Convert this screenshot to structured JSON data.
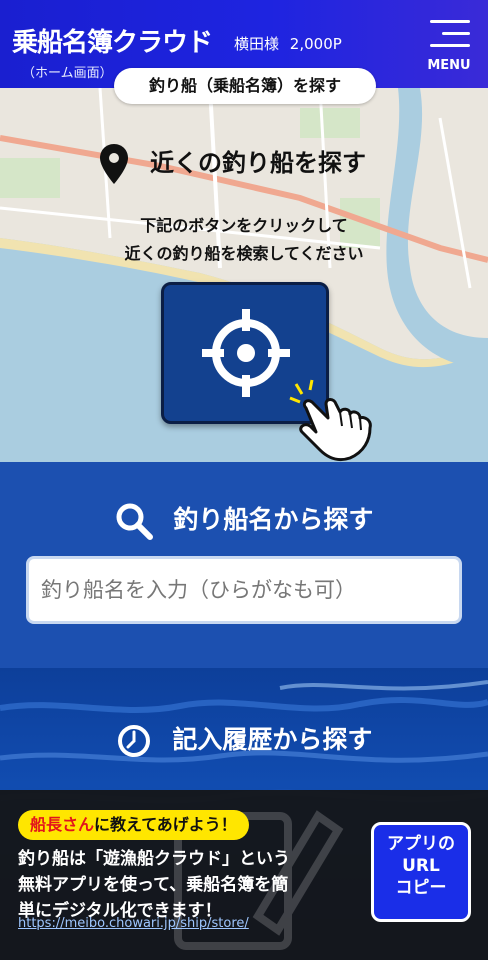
{
  "header": {
    "app_title": "乗船名簿クラウド",
    "subtitle": "（ホーム画面）",
    "user": "横田様",
    "points": "2,000P",
    "menu_label": "MENU"
  },
  "page_pill": "釣り船（乗船名簿）を探す",
  "nearby": {
    "title": "近くの釣り船を探す",
    "desc_line1": "下記のボタンをクリックして",
    "desc_line2": "近くの釣り船を検索してください"
  },
  "search": {
    "title": "釣り船名から探す",
    "placeholder": "釣り船名を入力（ひらがなも可）"
  },
  "history": {
    "title": "記入履歴から探す"
  },
  "promo": {
    "badge_red": "船長さん",
    "badge_rest": "に教えてあげよう！",
    "line1": "釣り船は「遊漁船クラウド」という",
    "line2": "無料アプリを使って、乗船名簿を簡",
    "line3": "単にデジタル化できます！",
    "link": "https://meibo.chowari.jp/ship/store/",
    "copy_line1": "アプリの",
    "copy_line2": "URL",
    "copy_line3": "コピー"
  },
  "colors": {
    "header": "#1e24e0",
    "search_bg": "#1c50b0",
    "button_bg": "#13418f",
    "badge": "#ffe600",
    "badge_red": "#e2141c",
    "copy_button": "#1a2ee8"
  },
  "icons": [
    "menu-icon",
    "map-pin-icon",
    "crosshair-icon",
    "pointing-hand-icon",
    "search-icon",
    "clock-icon"
  ]
}
